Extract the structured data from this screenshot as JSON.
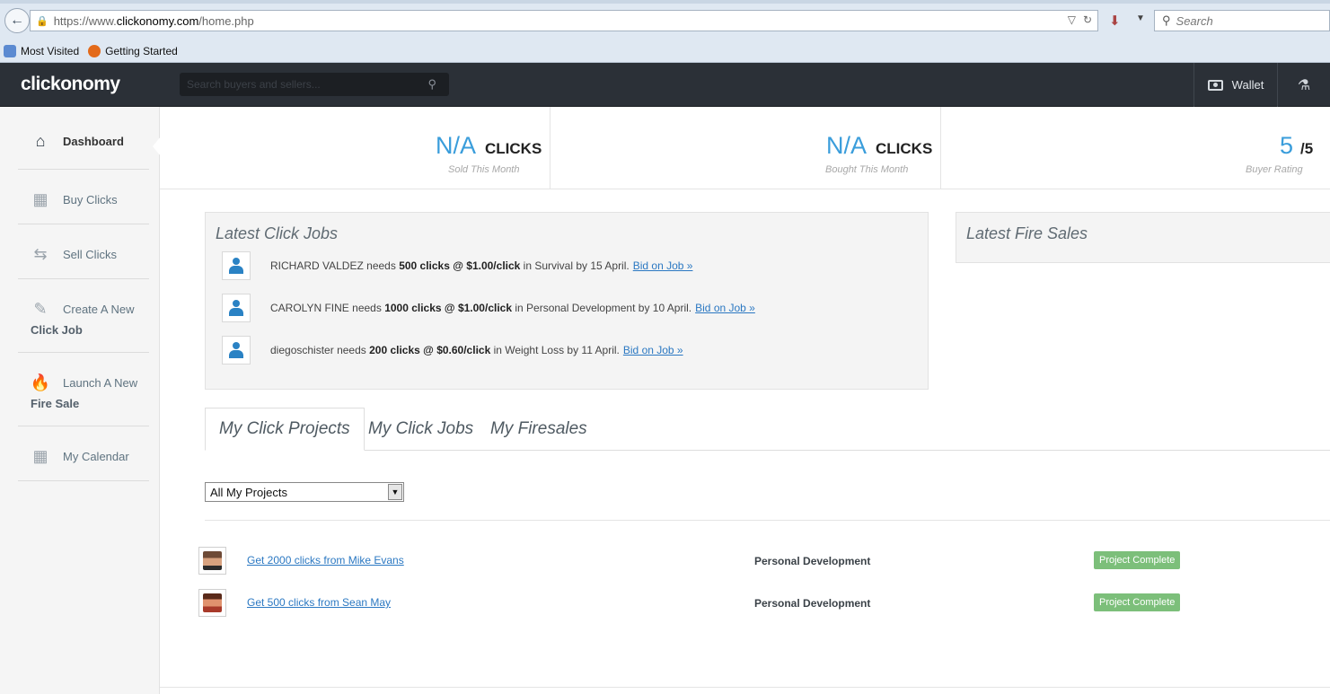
{
  "browser": {
    "url_prefix": "https://www.",
    "url_host": "clickonomy.com",
    "url_rest": "/home.php",
    "search_placeholder": "Search",
    "bookmarks": [
      "Most Visited",
      "Getting Started"
    ]
  },
  "header": {
    "logo": "clickonomy",
    "search_placeholder": "Search buyers and sellers...",
    "wallet_label": "Wallet"
  },
  "sidebar": {
    "items": [
      {
        "label": "Dashboard",
        "line2": ""
      },
      {
        "label": "Buy Clicks",
        "line2": ""
      },
      {
        "label": "Sell Clicks",
        "line2": ""
      },
      {
        "label": "Create A New",
        "line2": "Click Job"
      },
      {
        "label": "Launch A New",
        "line2": "Fire Sale"
      },
      {
        "label": "My Calendar",
        "line2": ""
      }
    ]
  },
  "stats": [
    {
      "value": "N/A",
      "unit": "CLICKS",
      "sub": "Sold This Month"
    },
    {
      "value": "N/A",
      "unit": "CLICKS",
      "sub": "Bought This Month"
    },
    {
      "value": "5",
      "unit": "/5",
      "sub": "Buyer Rating"
    }
  ],
  "latest_jobs": {
    "title": "Latest Click Jobs",
    "jobs": [
      {
        "name": "RICHARD VALDEZ",
        "needs": "needs",
        "offer": "500 clicks @ $1.00/click",
        "tail": "in Survival by 15 April.",
        "link": "Bid on Job »"
      },
      {
        "name": "CAROLYN FINE",
        "needs": "needs",
        "offer": "1000 clicks @ $1.00/click",
        "tail": "in Personal Development by 10 April.",
        "link": "Bid on Job »"
      },
      {
        "name": "diegoschister",
        "needs": "needs",
        "offer": "200 clicks @ $0.60/click",
        "tail": "in Weight Loss by 11 April.",
        "link": "Bid on Job »"
      }
    ]
  },
  "fire_sales": {
    "title": "Latest Fire Sales"
  },
  "tabs": [
    "My Click Projects",
    "My Click Jobs",
    "My Firesales"
  ],
  "project_filter": {
    "selected": "All My Projects"
  },
  "projects": [
    {
      "title": "Get 2000 clicks from Mike Evans",
      "category": "Personal Development",
      "status": "Project Complete"
    },
    {
      "title": "Get 500 clicks from Sean May",
      "category": "Personal Development",
      "status": "Project Complete"
    }
  ],
  "colors": {
    "accent": "#3a9ddb",
    "header_bg": "#2b3037",
    "status_green": "#7cbf7a",
    "link": "#2b78c2"
  }
}
